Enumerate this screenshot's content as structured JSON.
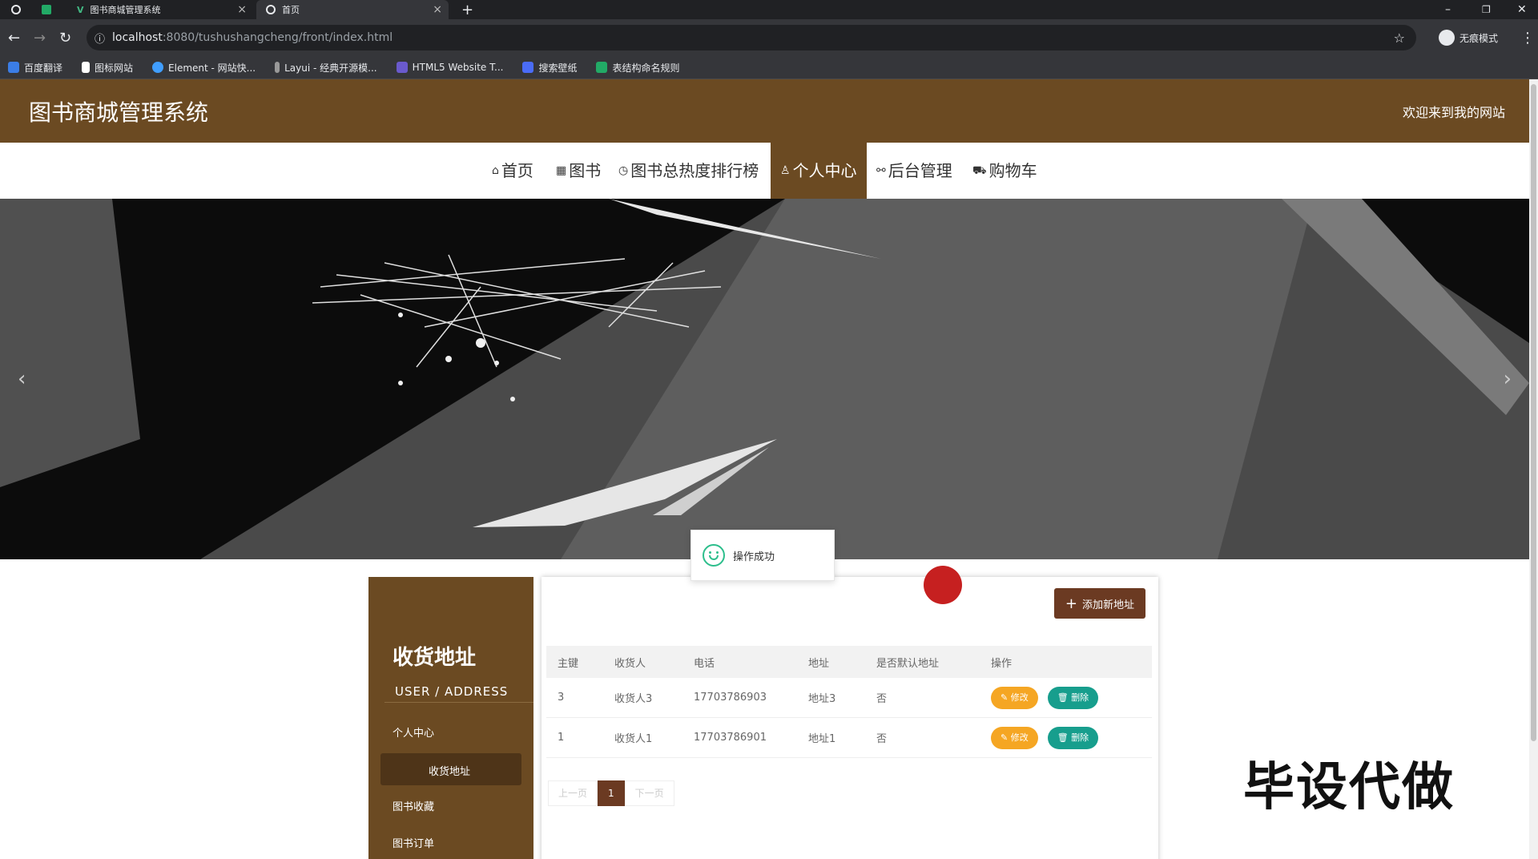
{
  "browser": {
    "tabs": [
      {
        "label": "图书商城管理系统"
      },
      {
        "label": "首页"
      }
    ],
    "url_host": "localhost",
    "url_path": ":8080/tushushangcheng/front/index.html",
    "profile_label": "无痕模式",
    "bookmarks": [
      {
        "label": "百度翻译",
        "color": "#3b7de6"
      },
      {
        "label": "图标网站",
        "color": "#ffffff"
      },
      {
        "label": "Element - 网站快...",
        "color": "#409eff"
      },
      {
        "label": "Layui - 经典开源模...",
        "color": "#cccccc"
      },
      {
        "label": "HTML5 Website T...",
        "color": "#6a5acd"
      },
      {
        "label": "搜索壁纸",
        "color": "#4a6cf7"
      },
      {
        "label": "表结构命名规则",
        "color": "#22aa66"
      }
    ]
  },
  "site": {
    "title": "图书商城管理系统",
    "welcome": "欢迎来到我的网站",
    "brand_color": "#6b4a22"
  },
  "nav": [
    {
      "label": "首页",
      "icon": "home-icon"
    },
    {
      "label": "图书",
      "icon": "grid-icon"
    },
    {
      "label": "图书总热度排行榜",
      "icon": "clock-icon"
    },
    {
      "label": "个人中心",
      "icon": "user-icon"
    },
    {
      "label": "后台管理",
      "icon": "link-icon"
    },
    {
      "label": "购物车",
      "icon": "cart-icon"
    }
  ],
  "toast": {
    "text": "操作成功"
  },
  "sidebar": {
    "title": "收货地址",
    "subtitle": "USER / ADDRESS",
    "items": [
      {
        "label": "个人中心"
      },
      {
        "label": "收货地址"
      },
      {
        "label": "图书收藏"
      },
      {
        "label": "图书订单"
      }
    ]
  },
  "panel": {
    "add_label": "添加新地址",
    "headers": [
      "主键",
      "收货人",
      "电话",
      "地址",
      "是否默认地址",
      "操作"
    ],
    "rows": [
      {
        "id": "3",
        "name": "收货人3",
        "phone": "17703786903",
        "address": "地址3",
        "default": "否"
      },
      {
        "id": "1",
        "name": "收货人1",
        "phone": "17703786901",
        "address": "地址1",
        "default": "否"
      }
    ],
    "edit_label": "修改",
    "delete_label": "删除",
    "pager": {
      "prev": "上一页",
      "current": "1",
      "next": "下一页"
    }
  },
  "watermark": "毕设代做"
}
